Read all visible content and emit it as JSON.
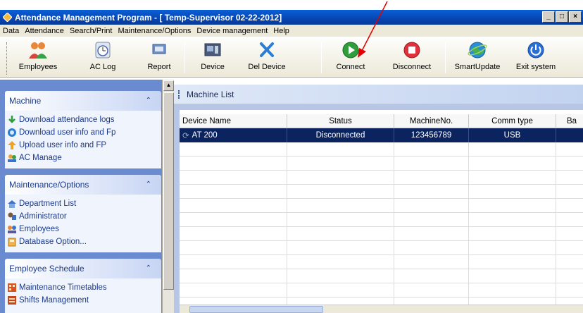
{
  "window": {
    "title": "Attendance Management Program - [ Temp-Supervisor 02-22-2012]",
    "controls": [
      "_",
      "□",
      "×"
    ]
  },
  "menu": [
    {
      "label": "Data"
    },
    {
      "label": "Attendance"
    },
    {
      "label": "Search/Print"
    },
    {
      "label": "Maintenance/Options"
    },
    {
      "label": "Device management"
    },
    {
      "label": "Help"
    }
  ],
  "toolbar": [
    {
      "label": "Employees",
      "icon": "employees-icon"
    },
    {
      "label": "AC Log",
      "icon": "clock-icon"
    },
    {
      "label": "Report",
      "icon": "report-icon"
    },
    {
      "label": "Device",
      "icon": "device-icon"
    },
    {
      "label": "Del Device",
      "icon": "delete-icon"
    },
    {
      "label": "Connect",
      "icon": "connect-icon"
    },
    {
      "label": "Disconnect",
      "icon": "disconnect-icon"
    },
    {
      "label": "SmartUpdate",
      "icon": "globe-icon"
    },
    {
      "label": "Exit system",
      "icon": "power-icon"
    }
  ],
  "sidebar": {
    "sections": [
      {
        "title": "Machine",
        "items": [
          {
            "label": "Download attendance logs",
            "icon": "download-icon"
          },
          {
            "label": "Download user info and Fp",
            "icon": "user-download-icon"
          },
          {
            "label": "Upload user info and FP",
            "icon": "upload-icon"
          },
          {
            "label": "AC Manage",
            "icon": "ac-manage-icon"
          }
        ]
      },
      {
        "title": "Maintenance/Options",
        "items": [
          {
            "label": "Department List",
            "icon": "department-icon"
          },
          {
            "label": "Administrator",
            "icon": "administrator-icon"
          },
          {
            "label": "Employees",
            "icon": "employees-icon"
          },
          {
            "label": "Database Option...",
            "icon": "database-icon"
          }
        ]
      },
      {
        "title": "Employee Schedule",
        "items": [
          {
            "label": "Maintenance Timetables",
            "icon": "timetable-icon"
          },
          {
            "label": "Shifts Management",
            "icon": "shifts-icon"
          }
        ]
      }
    ]
  },
  "main": {
    "title": "Machine List",
    "columns": [
      "Device Name",
      "Status",
      "MachineNo.",
      "Comm type",
      "Ba"
    ],
    "rows": [
      {
        "device": "AT 200",
        "status": "Disconnected",
        "machine_no": "123456789",
        "comm": "USB",
        "extra": ""
      }
    ]
  },
  "colors": {
    "titlebar": "#0746b0",
    "sidebar_bg": "#6b8bd1",
    "selected_row": "#0b2460",
    "annotation_arrow": "#e00000"
  }
}
